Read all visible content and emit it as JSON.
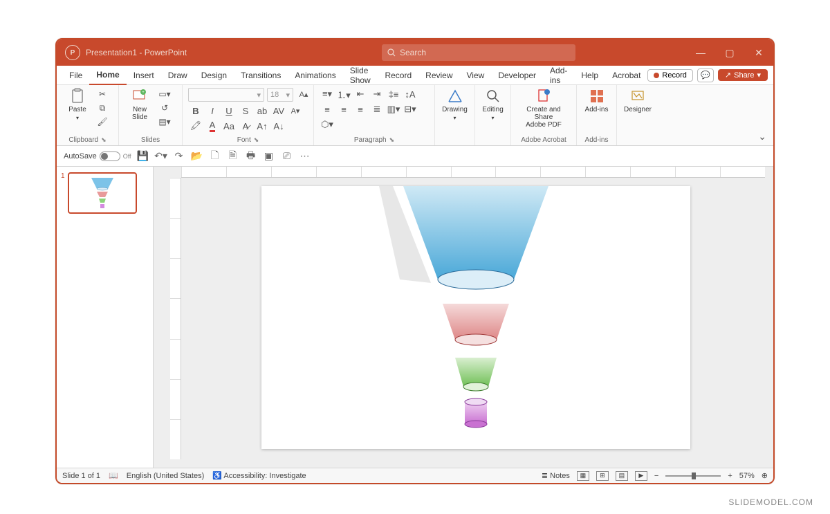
{
  "titlebar": {
    "doc_title": "Presentation1 - PowerPoint",
    "search_placeholder": "Search"
  },
  "tabs": {
    "items": [
      "File",
      "Home",
      "Insert",
      "Draw",
      "Design",
      "Transitions",
      "Animations",
      "Slide Show",
      "Record",
      "Review",
      "View",
      "Developer",
      "Add-ins",
      "Help",
      "Acrobat"
    ],
    "active_index": 1,
    "record_label": "Record",
    "share_label": "Share"
  },
  "ribbon": {
    "clipboard": {
      "paste": "Paste",
      "label": "Clipboard"
    },
    "slides": {
      "new_slide": "New\nSlide",
      "label": "Slides"
    },
    "font": {
      "size": "18",
      "label": "Font",
      "bold": "B",
      "italic": "I",
      "underline": "U",
      "strike": "S"
    },
    "paragraph": {
      "label": "Paragraph"
    },
    "drawing": {
      "label": "Drawing",
      "btn": "Drawing"
    },
    "editing": {
      "label": "Editing",
      "btn": "Editing"
    },
    "acrobat": {
      "btn": "Create and Share\nAdobe PDF",
      "label": "Adobe Acrobat"
    },
    "addins": {
      "btn": "Add-ins",
      "label": "Add-ins"
    },
    "designer": {
      "btn": "Designer"
    }
  },
  "qat": {
    "autosave": "AutoSave",
    "autosave_state": "Off"
  },
  "slide_content": {
    "type": "funnel",
    "segments": [
      {
        "color_top": "#a9d9f0",
        "color_bottom": "#4aa8d8",
        "shape": "cone"
      },
      {
        "color_top": "#f1c1c1",
        "color_bottom": "#de8787",
        "shape": "cone"
      },
      {
        "color_top": "#b8e3a6",
        "color_bottom": "#6fbf55",
        "shape": "cone"
      },
      {
        "color_top": "#e3b3e8",
        "color_bottom": "#c971d1",
        "shape": "cylinder"
      }
    ]
  },
  "thumbnails": {
    "count": 1,
    "selected": 1
  },
  "status": {
    "slide_info": "Slide 1 of 1",
    "language": "English (United States)",
    "accessibility": "Accessibility: Investigate",
    "notes": "Notes",
    "zoom": "57%"
  },
  "watermark": "SLIDEMODEL.COM"
}
